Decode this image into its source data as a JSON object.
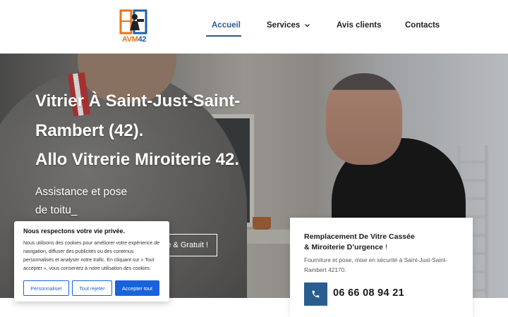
{
  "brand": {
    "logo_text_a": "AVM",
    "logo_text_b": "42"
  },
  "nav": {
    "items": [
      {
        "label": "Accueil",
        "active": true
      },
      {
        "label": "Services",
        "has_dropdown": true
      },
      {
        "label": "Avis clients"
      },
      {
        "label": "Contacts"
      }
    ]
  },
  "hero": {
    "title_line1": "Vitrier À Saint-Just-Saint-",
    "title_line2": "Rambert (42).",
    "title_line3": "Allo Vitrerie Miroiterie 42.",
    "subtitle_line1": "Assistance et pose",
    "subtitle_line2": "de toitu_",
    "cta_label": "e & Gratuit !"
  },
  "cookie_banner": {
    "title": "Nous respectons votre vie privée.",
    "text": "Nous utilisons des cookies pour améliorer votre expérience de navigation, diffuser des publicités ou des contenus personnalisés et analyser notre trafic. En cliquant sur « Tout accepter », vous consentez à notre utilisation des cookies.",
    "btn_customize": "Personnaliser",
    "btn_reject": "Tout rejeter",
    "btn_accept": "Accepter tout"
  },
  "card": {
    "title_line1": "Remplacement De Vitre Cassée",
    "title_line2_bold": "& Miroiterie D’urgence",
    "title_line2_suffix": " !",
    "description": "Fourniture et pose, mise en sécurité à Saint-Just-Saint-Rambert 42170.",
    "phone": "06 66 08 94 21"
  },
  "colors": {
    "accent": "#2a5d8f",
    "cookie_blue": "#1863dc",
    "logo_orange": "#e8731a"
  },
  "icons": {
    "nav_dropdown": "chevron-down-icon",
    "phone": "phone-icon"
  }
}
